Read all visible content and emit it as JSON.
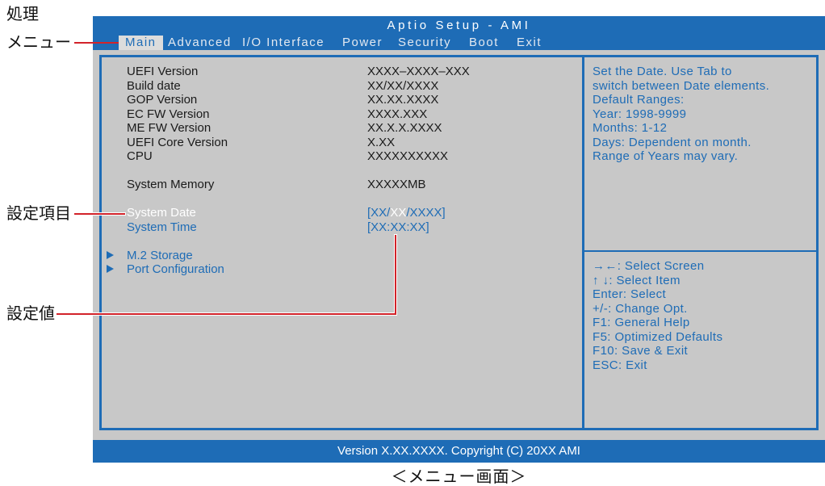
{
  "annotations": {
    "processing": "処理",
    "menu": "メニュー",
    "setting_item": "設定項目",
    "setting_value": "設定値",
    "caption": "＜メニュー画面＞"
  },
  "colors": {
    "bios_blue": "#1e6cb6",
    "panel_gray": "#c8c8c8",
    "selected_text": "#ffffff",
    "leader_red": "#d2232a"
  },
  "bios": {
    "title": "Aptio Setup - AMI",
    "menu": [
      {
        "label": "Main",
        "selected": true
      },
      {
        "label": "Advanced"
      },
      {
        "label": "I/O Interface"
      },
      {
        "label": "Power"
      },
      {
        "label": "Security"
      },
      {
        "label": "Boot"
      },
      {
        "label": "Exit"
      }
    ],
    "info": [
      {
        "label": "UEFI Version",
        "value": "XXXX–XXXX–XXX"
      },
      {
        "label": "Build date",
        "value": "XX/XX/XXXX"
      },
      {
        "label": "GOP Version",
        "value": "XX.XX.XXXX"
      },
      {
        "label": "EC FW Version",
        "value": "XXXX.XXX"
      },
      {
        "label": "ME FW Version",
        "value": "XX.X.X.XXXX"
      },
      {
        "label": "UEFI Core Version",
        "value": "X.XX"
      },
      {
        "label": "CPU",
        "value": "XXXXXXXXXX"
      }
    ],
    "memory": {
      "label": "System Memory",
      "value": "XXXXXMB"
    },
    "date": {
      "label": "System Date",
      "value_before": "[XX/",
      "value_selected": "XX",
      "value_after": "/XXXX]"
    },
    "time": {
      "label": "System Time",
      "value": "[XX:XX:XX]"
    },
    "submenus": [
      {
        "label": "M.2 Storage",
        "icon": "triangle-right-icon"
      },
      {
        "label": "Port Configuration",
        "icon": "triangle-right-icon"
      }
    ],
    "help": [
      "Set the Date. Use Tab to",
      "switch between Date elements.",
      "Default Ranges:",
      "Year: 1998-9999",
      "Months: 1-12",
      "Days: Dependent on month.",
      "Range of Years may vary."
    ],
    "keys": [
      "→←: Select Screen",
      "↑ ↓: Select Item",
      "Enter: Select",
      "+/-: Change Opt.",
      "F1: General Help",
      "F5: Optimized Defaults",
      "F10: Save & Exit",
      "ESC: Exit"
    ],
    "footer": "Version X.XX.XXXX. Copyright (C) 20XX AMI"
  }
}
